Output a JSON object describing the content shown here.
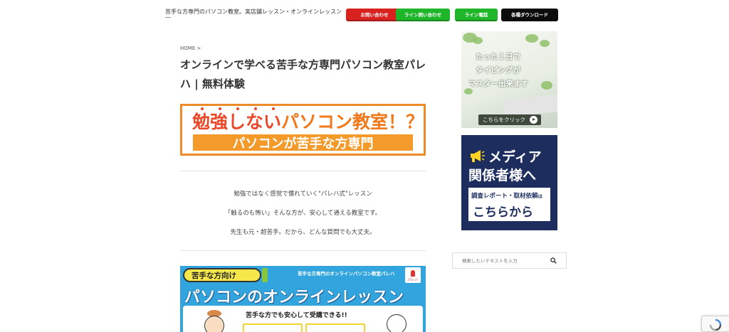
{
  "header": {
    "site_description": "苦手な方専門のパソコン教室。実店舗レッスン・オンラインレッスン",
    "buttons": {
      "contact": "お問い合わせ",
      "line_contact": "ライン問い合わせ",
      "line_call": "ライン電話",
      "downloads": "各種ダウンロード"
    }
  },
  "main": {
    "breadcrumb": "HOME >",
    "title": "オンラインで学べる苦手な方専門パソコン教室パレハ | 無料体験",
    "hero": {
      "line1_red": "勉強しない",
      "line1_orange": "パソコン教室！？",
      "line2": "パソコンが苦手な方専門"
    },
    "intro_lines": [
      "勉強ではなく感覚で慣れていく\"パレハ式\"レッスン",
      "「触るのも怖い」そんな方が、安心して通える教室です。",
      "先生も元・超苦手。だから、どんな質問でも大丈夫。"
    ],
    "online_banner": {
      "tag": "苦手な方向け",
      "caption": "苦手な方専門のオンラインパソコン教室パレハ",
      "logo_text": "パレハ",
      "title": "パソコンのオンラインレッスン",
      "subtitle": "苦手な方でも安心して受講できる!!"
    }
  },
  "sidebar": {
    "typing_banner": {
      "line1": "たった１日で",
      "line2": "タイピングが",
      "line3": "マスター出来ます",
      "button": "こちらをクリック"
    },
    "media_banner": {
      "line1": "メディア",
      "line2": "関係者様へ",
      "box_line1": "調査レポート・取材依頼",
      "box_line1_suffix": "は",
      "box_line2": "こちらから"
    },
    "search": {
      "placeholder": "検索したいテキストを入力"
    }
  },
  "colors": {
    "contact_button": "#d8221f",
    "line_button": "#1fb62a",
    "download_button": "#0c0c0c",
    "hero_orange": "#ef8a2a",
    "hero_red": "#ea4a2a",
    "online_banner_blue": "#33a5de",
    "media_navy": "#1c2d5e"
  }
}
